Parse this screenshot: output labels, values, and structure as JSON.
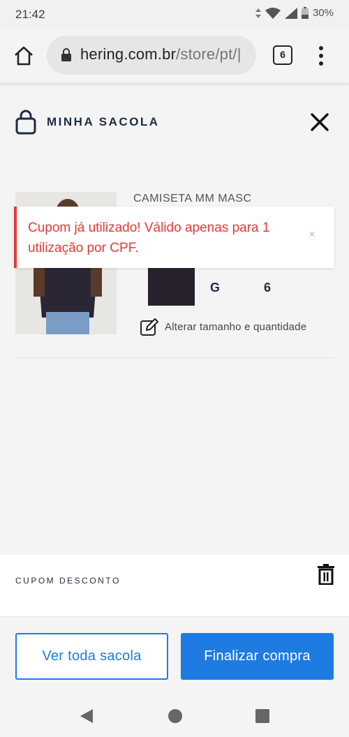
{
  "status_bar": {
    "time": "21:42",
    "battery": "30%"
  },
  "browser": {
    "url_host": "hering.com.br",
    "url_path": "/store/pt/|",
    "tab_count": "6"
  },
  "bag": {
    "title": "MINHA SACOLA"
  },
  "product": {
    "name": "CAMISETA MM MASC",
    "size": "G",
    "quantity": "6",
    "edit_label": "Alterar tamanho e quantidade",
    "swatch_color": "#27222e"
  },
  "alert": {
    "message": "Cupom já utilizado! Válido apenas para 1 utilização por CPF.",
    "close_symbol": "×",
    "color": "#e53935"
  },
  "coupon": {
    "label": "CUPOM DESCONTO"
  },
  "footer": {
    "view_bag_label": "Ver toda sacola",
    "checkout_label": "Finalizar compra",
    "accent_color": "#1e7be1"
  },
  "icons": {
    "home": "home-icon",
    "lock": "lock-icon",
    "tabs": "tabs-icon",
    "menu": "more-vert-icon",
    "bag": "shopping-bag-icon",
    "close": "close-icon",
    "edit": "edit-icon",
    "trash": "trash-icon",
    "back": "back-icon",
    "home_nav": "home-circle-icon",
    "recents": "recents-icon"
  }
}
